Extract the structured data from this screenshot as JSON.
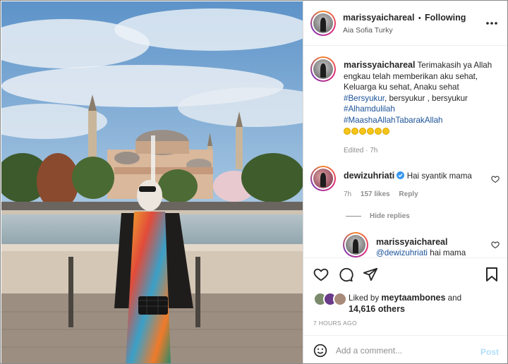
{
  "post": {
    "author": "marissyaichareal",
    "follow_separator": "•",
    "follow_status": "Following",
    "location": "Aia Sofia Turky",
    "more_icon": "more-horizontal-icon"
  },
  "caption": {
    "author": "marissyaichareal",
    "line1": "Terimakasih ya Allah",
    "line2": "engkau telah memberikan aku sehat,",
    "line3": "Keluarga ku sehat, Anaku sehat",
    "hashtag1": "#Bersyukur",
    "line4_rest": ", bersyukur , bersyukur",
    "hashtag2": "#Alhamdulilah",
    "hashtag3": "#MaashaAllahTabarakAllah",
    "edited": "Edited · 7h"
  },
  "comments": [
    {
      "author": "dewizuhriati",
      "verified": true,
      "text": "Hai syantik mama",
      "age": "7h",
      "likes": "157 likes",
      "reply": "Reply",
      "hide_replies": "Hide replies"
    }
  ],
  "reply": {
    "author": "marissyaichareal",
    "mention": "@dewizuhriati",
    "text": "hai mama"
  },
  "liked_by": {
    "prefix": "Liked by",
    "user": "meytaambones",
    "and": "and",
    "others": "14,616 others"
  },
  "timestamp": "7 HOURS AGO",
  "add_comment": {
    "placeholder": "Add a comment...",
    "post_label": "Post"
  },
  "colors": {
    "link_blue": "#1b5299",
    "post_button": "#b2dffc",
    "muted": "#8e8e8e",
    "verified": "#3897f0"
  }
}
